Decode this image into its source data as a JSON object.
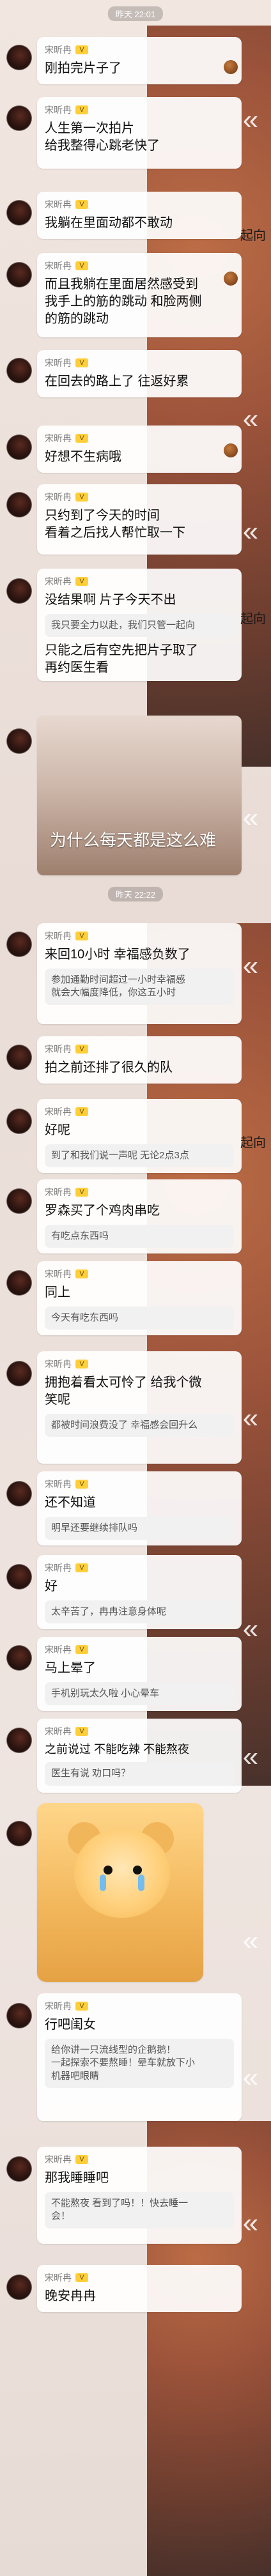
{
  "times": {
    "first": "昨天 22:01",
    "second": "昨天 22:22"
  },
  "user": {
    "name": "宋昕冉",
    "level": "V"
  },
  "ui": {
    "reply_symbol": "«",
    "side_label": "起向"
  },
  "images": [
    {
      "caption": "为什么每天都是这么难"
    }
  ],
  "messages": [
    {
      "text": "刚拍完片子了"
    },
    {
      "text": "人生第一次拍片\n给我整得心跳老快了"
    },
    {
      "text": "我躺在里面动都不敢动"
    },
    {
      "text": "而且我躺在里面居然感受到\n我手上的筋的跳动 和脸两侧\n的筋的跳动"
    },
    {
      "text": "在回去的路上了 往返好累"
    },
    {
      "text": "好想不生病哦"
    },
    {
      "text": "只约到了今天的时间\n看着之后找人帮忙取一下"
    },
    {
      "text": "没结果啊 片子今天不出"
    },
    {
      "text": "我只要全力以赴，我们只管一起向",
      "is_quote": true
    },
    {
      "text": "只能之后有空先把片子取了\n再约医生看"
    },
    {
      "text": "来回10小时 幸福感负数了"
    },
    {
      "text": "参加通勤时间超过一小时幸福感\n就会大幅度降低，你这五小时",
      "is_quote": true
    },
    {
      "text": "拍之前还排了很久的队"
    },
    {
      "text": "好呢"
    },
    {
      "text": "到了和我们说一声呢 无论2点3点",
      "is_quote": true
    },
    {
      "text": "罗森买了个鸡肉串吃"
    },
    {
      "text": "有吃点东西吗",
      "is_quote": true
    },
    {
      "text": "同上"
    },
    {
      "text": "今天有吃东西吗",
      "is_quote": true
    },
    {
      "text": "拥抱着看太可怜了 给我个微\n笑呢"
    },
    {
      "text": "都被时间浪费没了 幸福感会回升么",
      "is_quote": true
    },
    {
      "text": "还不知道"
    },
    {
      "text": "明早还要继续排队吗",
      "is_quote": true
    },
    {
      "text": "好"
    },
    {
      "text": "太辛苦了，冉冉注意身体呢",
      "is_quote": true
    },
    {
      "text": "马上晕了"
    },
    {
      "text": "手机别玩太久啦 小心晕车",
      "is_quote": true
    },
    {
      "text": "之前说过 不能吃辣 不能熬夜"
    },
    {
      "text": "医生有说 劝口吗？",
      "is_quote": true
    },
    {
      "text": "行吧闺女"
    },
    {
      "text": "给你讲一只流线型的企鹅鹅！\n一起探索不要熬睡！晕车就放下小\n机器吧眼睛",
      "is_quote": true
    },
    {
      "text": "那我睡睡吧"
    },
    {
      "text": "不能熬夜 看到了吗！！快去睡一\n会！",
      "is_quote": true
    },
    {
      "text": "晚安冉冉"
    }
  ]
}
